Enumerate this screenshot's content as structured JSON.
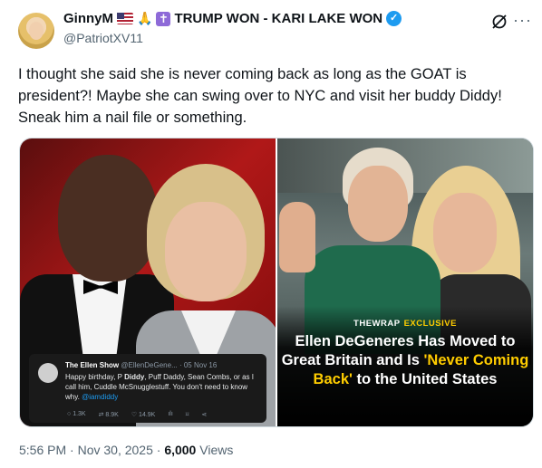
{
  "author": {
    "display_name": "GinnyM",
    "display_suffix": "TRUMP WON - KARI LAKE WON",
    "handle": "@PatriotXV11",
    "flag_icon": "us-flag-icon",
    "pray_icon": "folded-hands-icon",
    "cross_icon": "latin-cross-icon",
    "verified_icon": "verified-badge-icon"
  },
  "header_actions": {
    "grok_icon": "grok-slash-icon",
    "more_label": "···"
  },
  "tweet": {
    "text": "I thought she said she is never coming back as long as the GOAT is president?! Maybe she can swing over to NYC and visit her buddy Diddy! Sneak him a nail file or something."
  },
  "media": {
    "left_image": {
      "embedded_tweet": {
        "name": "The Ellen Show",
        "meta": "@EllenDeGene... · 05 Nov 16",
        "body_1": "Happy birthday, P ",
        "body_bold": "Diddy",
        "body_2": ", Puff Daddy, Sean Combs, or as I call him, Cuddle McSnugglestuff. You don't need to know why. ",
        "mention": "@iamdiddy",
        "stats": [
          "1.3K",
          "8.9K",
          "14.9K"
        ]
      }
    },
    "right_image": {
      "tag_brand": "THEWRAP",
      "tag_label": "EXCLUSIVE",
      "headline_1": "Ellen DeGeneres Has Moved to Great Britain and Is ",
      "headline_highlight": "'Never Coming Back'",
      "headline_2": " to the United States"
    }
  },
  "footer": {
    "time": "5:56 PM · Nov 30, 2025 · ",
    "views_count": "6,000",
    "views_label": " Views"
  },
  "colors": {
    "accent": "#1d9bf0",
    "secondary_text": "#536471",
    "highlight": "#ffcd00"
  }
}
